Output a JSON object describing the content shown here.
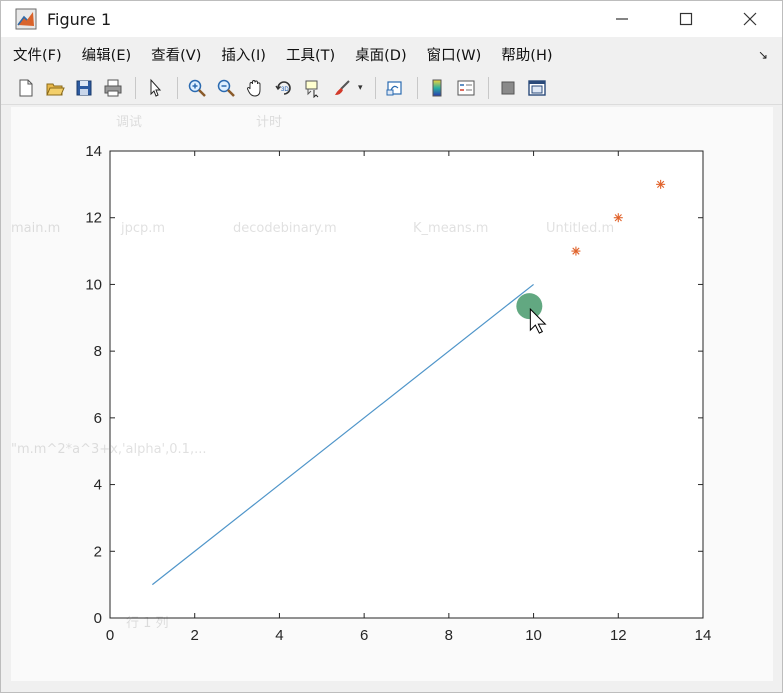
{
  "window": {
    "title": "Figure 1",
    "controls": {
      "minimize": "minimize-icon",
      "maximize": "maximize-icon",
      "close": "close-icon"
    }
  },
  "menu": {
    "items": [
      {
        "label": "文件(F)"
      },
      {
        "label": "编辑(E)"
      },
      {
        "label": "查看(V)"
      },
      {
        "label": "插入(I)"
      },
      {
        "label": "工具(T)"
      },
      {
        "label": "桌面(D)"
      },
      {
        "label": "窗口(W)"
      },
      {
        "label": "帮助(H)"
      }
    ]
  },
  "toolbar": {
    "buttons": [
      "new-figure-icon",
      "open-file-icon",
      "save-icon",
      "print-icon",
      "pointer-icon",
      "zoom-in-icon",
      "zoom-out-icon",
      "pan-icon",
      "rotate-3d-icon",
      "data-cursor-icon",
      "brush-icon",
      "link-plot-icon",
      "colorbar-icon",
      "legend-icon",
      "hide-plot-tools-icon",
      "show-plot-tools-icon"
    ]
  },
  "background_text": {
    "files": [
      "main.m",
      "jpcp.m",
      "decodebinary.m",
      "K_means.m",
      "Untitled.m"
    ],
    "hints": [
      "调试",
      "计时"
    ],
    "code": "\"m.m^2*a^3+x,'alpha',0.1,...",
    "status": "行 1 列"
  },
  "chart_data": {
    "type": "line",
    "xlim": [
      0,
      14
    ],
    "ylim": [
      0,
      14
    ],
    "xticks": [
      0,
      2,
      4,
      6,
      8,
      10,
      12,
      14
    ],
    "yticks": [
      0,
      2,
      4,
      6,
      8,
      10,
      12,
      14
    ],
    "grid": false,
    "series": [
      {
        "kind": "line",
        "color": "#4f95c9",
        "x": [
          1,
          10
        ],
        "y": [
          1,
          10
        ]
      },
      {
        "kind": "scatter",
        "marker": "*",
        "color": "#e0622a",
        "x": [
          11,
          12,
          13
        ],
        "y": [
          11,
          12,
          13
        ]
      }
    ],
    "cursor_highlight": {
      "x": 9.9,
      "y": 9.35,
      "color": "#2e8b57"
    }
  }
}
